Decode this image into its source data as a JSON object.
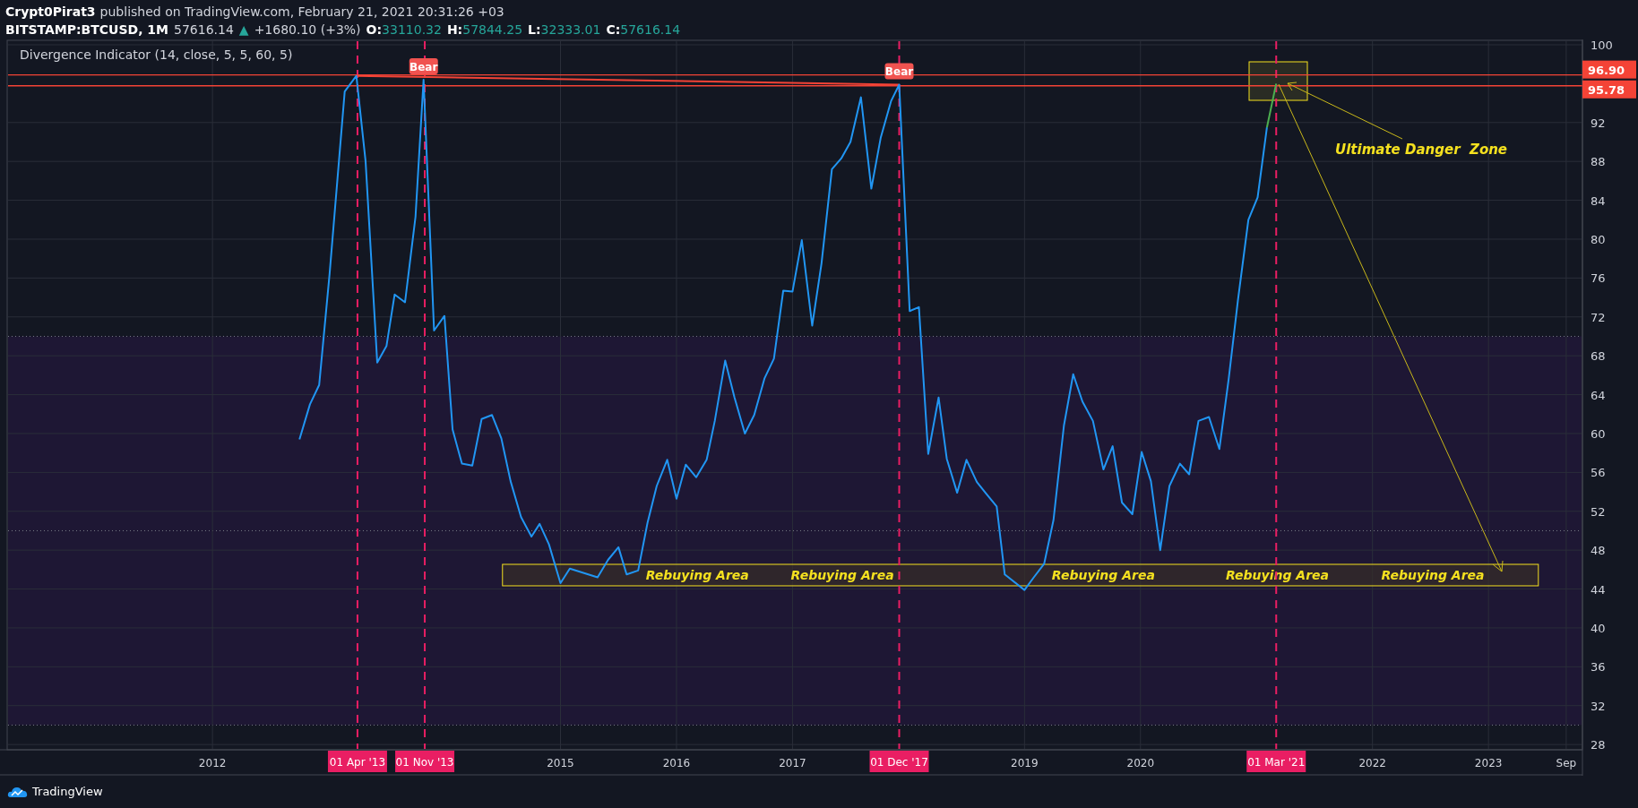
{
  "header": {
    "author": "Crypt0Pirat3",
    "published": "published on TradingView.com, February 21, 2021 20:31:26 +03",
    "symbol": "BITSTAMP:BTCUSD, 1M",
    "price": "57616.14",
    "change_icon": "▲",
    "change": "+1680.10 (+3%)",
    "ohlc": [
      {
        "label": "O:",
        "value": "33110.32"
      },
      {
        "label": "H:",
        "value": "57844.25"
      },
      {
        "label": "L:",
        "value": "32333.01"
      },
      {
        "label": "C:",
        "value": "57616.14"
      }
    ]
  },
  "chart": {
    "indicator": "Divergence Indicator (14, close, 5, 5, 60, 5)",
    "chart_data": {
      "type": "line",
      "grid": true,
      "x": [
        2012.75,
        2012.84,
        2012.92,
        2013.01,
        2013.14,
        2013.24,
        2013.32,
        2013.42,
        2013.5,
        2013.57,
        2013.66,
        2013.75,
        2013.82,
        2013.91,
        2014.0,
        2014.07,
        2014.15,
        2014.24,
        2014.32,
        2014.41,
        2014.49,
        2014.57,
        2014.66,
        2014.75,
        2014.82,
        2014.9,
        2015.0,
        2015.08,
        2015.32,
        2015.41,
        2015.5,
        2015.57,
        2015.67,
        2015.75,
        2015.83,
        2015.92,
        2016.0,
        2016.08,
        2016.17,
        2016.26,
        2016.33,
        2016.42,
        2016.5,
        2016.59,
        2016.67,
        2016.76,
        2016.84,
        2016.92,
        2017.0,
        2017.08,
        2017.17,
        2017.25,
        2017.34,
        2017.42,
        2017.5,
        2017.59,
        2017.68,
        2017.76,
        2017.85,
        2017.92,
        2018.01,
        2018.09,
        2018.17,
        2018.26,
        2018.33,
        2018.42,
        2018.5,
        2018.59,
        2018.67,
        2018.76,
        2018.83,
        2019.0,
        2019.08,
        2019.17,
        2019.25,
        2019.34,
        2019.42,
        2019.5,
        2019.59,
        2019.68,
        2019.76,
        2019.84,
        2019.93,
        2020.01,
        2020.09,
        2020.17,
        2020.25,
        2020.34,
        2020.42,
        2020.5,
        2020.59,
        2020.68,
        2020.76,
        2020.84,
        2020.93,
        2021.01,
        2021.09,
        2021.17
      ],
      "series": [
        {
          "color": "#2196f3",
          "values": [
            59.4,
            63,
            65,
            76.5,
            95.2,
            96.8,
            88,
            67.3,
            69,
            74.3,
            73.5,
            82.3,
            96.4,
            70.6,
            72.1,
            60.4,
            56.9,
            56.7,
            61.5,
            61.9,
            59.5,
            55.1,
            51.4,
            49.4,
            50.7,
            48.6,
            44.6,
            46.1,
            45.2,
            47,
            48.3,
            45.5,
            45.9,
            50.8,
            54.6,
            57.3,
            53.3,
            56.8,
            55.5,
            57.3,
            61.3,
            67.5,
            63.7,
            60,
            61.9,
            65.7,
            67.7,
            74.7,
            74.6,
            79.9,
            71.1,
            77.5,
            87.2,
            88.3,
            90,
            94.6,
            85.2,
            90.4,
            94.2,
            95.9,
            72.6,
            73,
            57.9,
            63.7,
            57.4,
            53.9,
            57.3,
            55,
            53.8,
            52.5,
            45.5,
            43.9,
            45.2,
            46.6,
            51.1,
            60.8,
            66.1,
            63.3,
            61.3,
            56.3,
            58.7,
            52.9,
            51.7,
            58.1,
            55.1,
            48,
            54.6,
            56.9,
            55.8,
            61.3,
            61.7,
            58.4,
            65.6,
            73.7,
            82,
            84.3,
            91.5,
            null
          ]
        },
        {
          "color": "#4caf50",
          "values": [
            null,
            null,
            null,
            null,
            null,
            null,
            null,
            null,
            null,
            null,
            null,
            null,
            null,
            null,
            null,
            null,
            null,
            null,
            null,
            null,
            null,
            null,
            null,
            null,
            null,
            null,
            null,
            null,
            null,
            null,
            null,
            null,
            null,
            null,
            null,
            null,
            null,
            null,
            null,
            null,
            null,
            null,
            null,
            null,
            null,
            null,
            null,
            null,
            null,
            null,
            null,
            null,
            null,
            null,
            null,
            null,
            null,
            null,
            null,
            null,
            null,
            null,
            null,
            null,
            null,
            null,
            null,
            null,
            null,
            null,
            null,
            null,
            null,
            null,
            null,
            null,
            null,
            null,
            null,
            null,
            null,
            null,
            null,
            null,
            null,
            null,
            null,
            null,
            null,
            null,
            null,
            null,
            null,
            null,
            null,
            null,
            91.5,
            96.0
          ]
        }
      ],
      "xlim": [
        2010.23,
        2023.81
      ],
      "ylim": [
        27.46,
        100.46
      ],
      "yticks": [
        100,
        92,
        88,
        84,
        80,
        76,
        72,
        68,
        64,
        60,
        56,
        52,
        48,
        44,
        40,
        36,
        32,
        28
      ],
      "xticks": [
        2012,
        2015,
        2016,
        2017,
        2019,
        2020,
        2022,
        2023,
        {
          "value": 2023.67,
          "label": "Sep"
        }
      ],
      "ref_lines": [
        {
          "axis": "y",
          "value": 96.9,
          "label": "96.90"
        },
        {
          "axis": "y",
          "value": 95.78,
          "label": "95.78"
        },
        {
          "axis": "x",
          "value": 2013.25,
          "label": "01 Apr '13"
        },
        {
          "axis": "x",
          "value": 2013.83,
          "label": "01 Nov '13"
        },
        {
          "axis": "x",
          "value": 2017.92,
          "label": "01 Dec '17"
        },
        {
          "axis": "x",
          "value": 2021.17,
          "label": "01 Mar '21"
        }
      ],
      "annotations": [
        {
          "text": "Bear",
          "x": 2013.82,
          "y": 96.4
        },
        {
          "text": "Bear",
          "x": 2017.92,
          "y": 95.9
        }
      ]
    },
    "danger_zone_label": "Ultimate Danger  Zone",
    "rebuying_labels": [
      "Rebuying Area",
      "Rebuying Area",
      "Rebuying Area",
      "Rebuying Area",
      "Rebuying Area"
    ]
  },
  "footer": {
    "brand": "TradingView"
  }
}
